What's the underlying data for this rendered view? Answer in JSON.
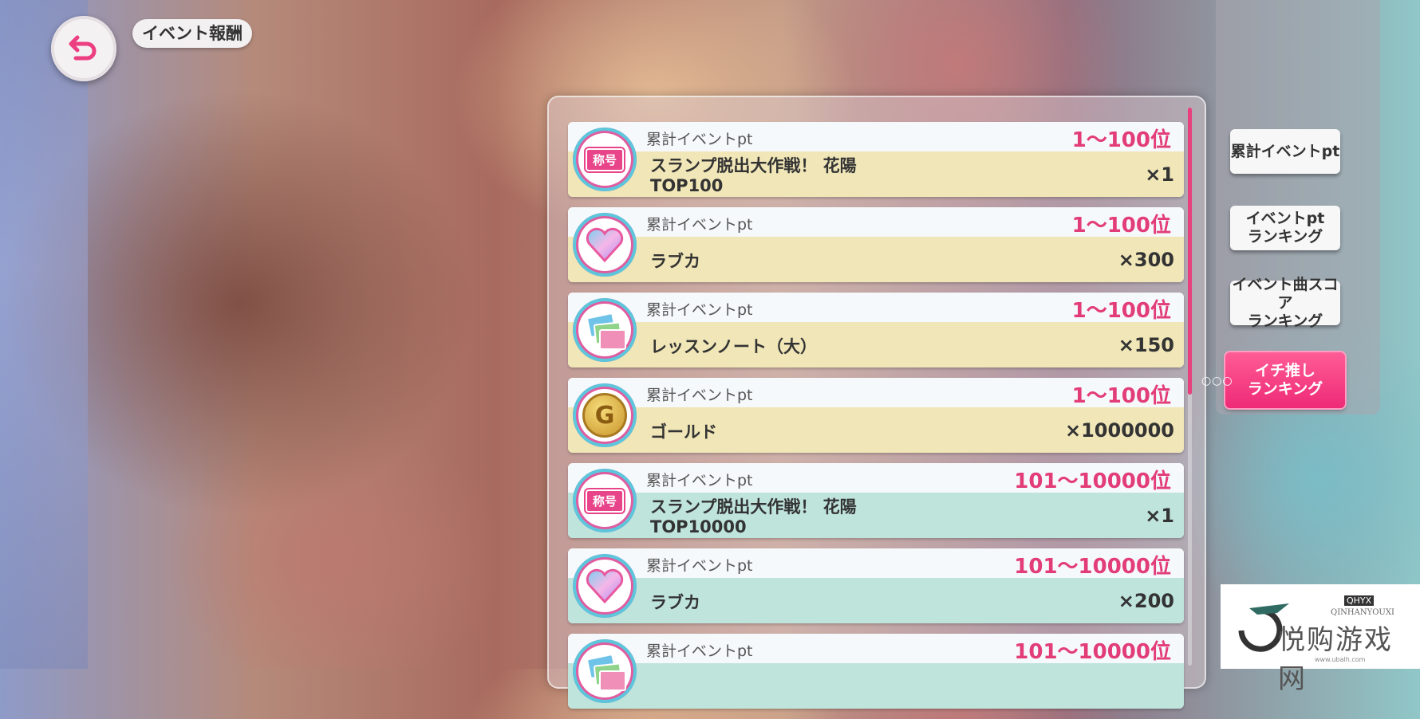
{
  "header": {
    "title": "イベント報酬"
  },
  "rewards": [
    {
      "condition": "累計イベントpt",
      "rank": "1～100位",
      "name": "スランプ脱出大作戦！ 花陽\nTOP100",
      "quantity": "×1",
      "icon": "title-badge-icon",
      "icon_label": "称号",
      "band": "yellow"
    },
    {
      "condition": "累計イベントpt",
      "rank": "1～100位",
      "name": "ラブカ",
      "quantity": "×300",
      "icon": "love-gem-icon",
      "band": "yellow"
    },
    {
      "condition": "累計イベントpt",
      "rank": "1～100位",
      "name": "レッスンノート（大）",
      "quantity": "×150",
      "icon": "lesson-note-icon",
      "band": "yellow"
    },
    {
      "condition": "累計イベントpt",
      "rank": "1～100位",
      "name": "ゴールド",
      "quantity": "×1000000",
      "icon": "gold-coin-icon",
      "icon_label": "G",
      "band": "yellow"
    },
    {
      "condition": "累計イベントpt",
      "rank": "101～10000位",
      "name": "スランプ脱出大作戦！ 花陽\nTOP10000",
      "quantity": "×1",
      "icon": "title-badge-icon",
      "icon_label": "称号",
      "band": "teal"
    },
    {
      "condition": "累計イベントpt",
      "rank": "101～10000位",
      "name": "ラブカ",
      "quantity": "×200",
      "icon": "love-gem-icon",
      "band": "teal"
    },
    {
      "condition": "累計イベントpt",
      "rank": "101～10000位",
      "name": "",
      "quantity": "",
      "icon": "lesson-note-icon",
      "band": "teal"
    }
  ],
  "tabs": [
    {
      "label": "累計イベントpt",
      "active": false
    },
    {
      "label": "イベントpt\nランキング",
      "active": false
    },
    {
      "label": "イベント曲スコア\nランキング",
      "active": false
    },
    {
      "label": "イチ推し\nランキング",
      "active": true
    }
  ],
  "watermark": {
    "brand": "悦购游戏网",
    "en": "QINHANYOUXI",
    "tag": "QHYX",
    "url": "www.ubalh.com"
  },
  "colors": {
    "accent": "#e8448a",
    "rank_text": "#e23d76",
    "yellow_band": "#f0e6b7",
    "teal_band": "#bfe4dc"
  }
}
